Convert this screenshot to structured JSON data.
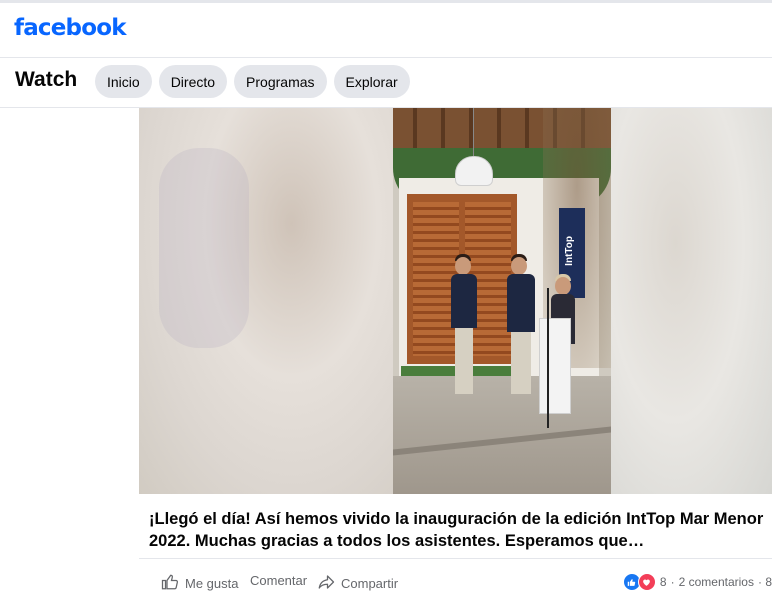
{
  "header": {
    "logo_text": "facebook",
    "brand_color": "#0866ff"
  },
  "watch": {
    "title": "Watch",
    "tabs": [
      {
        "label": "Inicio"
      },
      {
        "label": "Directo"
      },
      {
        "label": "Programas"
      },
      {
        "label": "Explorar"
      }
    ]
  },
  "video": {
    "banner_text": "IntTop"
  },
  "post": {
    "caption": "¡Llegó el día! Así hemos vivido la inauguración de la edición IntTop Mar Menor 2022. Muchas gracias a todos los asistentes. Esperamos que…",
    "actions": {
      "like": "Me gusta",
      "comment": "Comentar",
      "share": "Compartir"
    },
    "stats": {
      "reactions_count": "8",
      "separator": "·",
      "comments": "2 comentarios",
      "trailing": "· 8"
    },
    "icons": {
      "like": "thumbs-up-icon",
      "share": "share-arrow-icon",
      "reaction_like": "like-reaction-icon",
      "reaction_love": "love-reaction-icon"
    },
    "reaction_colors": {
      "like": "#1877f2",
      "love": "#f33e58"
    }
  }
}
